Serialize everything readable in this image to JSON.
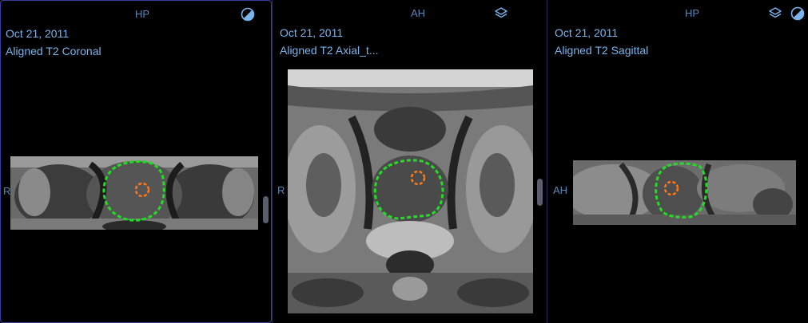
{
  "viewports": [
    {
      "orientation_top": "HP",
      "orientation_left": "R",
      "date": "Oct 21, 2011",
      "series": "Aligned T2 Coronal",
      "icons": [
        "contrast-icon"
      ]
    },
    {
      "orientation_top": "AH",
      "orientation_left": "R",
      "date": "Oct 21, 2011",
      "series": "Aligned T2 Axial_t...",
      "icons": [
        "layers-icon"
      ]
    },
    {
      "orientation_top": "HP",
      "orientation_left": "AH",
      "date": "Oct 21, 2011",
      "series": "Aligned T2 Sagittal",
      "icons": [
        "layers-icon",
        "contrast-icon"
      ]
    }
  ],
  "colors": {
    "active_border": "#3b3f9c",
    "text_accent": "#7ab4ec",
    "orientation_marker": "#5a86b5",
    "contour_gland": "#22dd22",
    "contour_lesion": "#ff7a1a"
  }
}
